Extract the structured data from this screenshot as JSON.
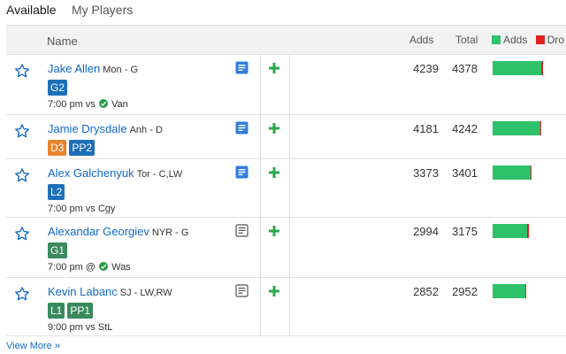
{
  "tabs": {
    "available": "Available",
    "my_players": "My Players"
  },
  "header": {
    "name": "Name",
    "adds": "Adds",
    "total": "Total",
    "legend_adds": "Adds",
    "legend_drops": "Dro"
  },
  "colors": {
    "adds": "#2ec26a",
    "drops": "#e02020",
    "link": "#1268c9"
  },
  "players": [
    {
      "name": "Jake Allen",
      "info": "Mon - G",
      "badges": [
        {
          "label": "G2",
          "color": "#1c6fb8"
        }
      ],
      "game_pre": "7:00 pm vs",
      "game_post": "Van",
      "check": true,
      "note_style": "blue",
      "adds": "4239",
      "total": "4378",
      "adds_fraction": 0.968,
      "drops_fraction": 0.032
    },
    {
      "name": "Jamie Drysdale",
      "info": "Anh - D",
      "badges": [
        {
          "label": "D3",
          "color": "#e8842c"
        },
        {
          "label": "PP2",
          "color": "#1c6fb8"
        }
      ],
      "game_pre": "",
      "game_post": "",
      "check": false,
      "note_style": "blue",
      "adds": "4181",
      "total": "4242",
      "adds_fraction": 0.986,
      "drops_fraction": 0.014
    },
    {
      "name": "Alex Galchenyuk",
      "info": "Tor - C,LW",
      "badges": [
        {
          "label": "L2",
          "color": "#1c6fb8"
        }
      ],
      "game_pre": "7:00 pm vs Cgy",
      "game_post": "",
      "check": false,
      "note_style": "blue",
      "adds": "3373",
      "total": "3401",
      "adds_fraction": 0.992,
      "drops_fraction": 0.008
    },
    {
      "name": "Alexandar Georgiev",
      "info": "NYR - G",
      "badges": [
        {
          "label": "G1",
          "color": "#3a8a5e"
        }
      ],
      "game_pre": "7:00 pm @",
      "game_post": "Was",
      "check": true,
      "note_style": "gray",
      "adds": "2994",
      "total": "3175",
      "adds_fraction": 0.943,
      "drops_fraction": 0.057
    },
    {
      "name": "Kevin Labanc",
      "info": "SJ - LW,RW",
      "badges": [
        {
          "label": "L1",
          "color": "#3a8a5e"
        },
        {
          "label": "PP1",
          "color": "#3a8a5e"
        }
      ],
      "game_pre": "9:00 pm vs StL",
      "game_post": "",
      "check": false,
      "note_style": "gray",
      "adds": "2852",
      "total": "2952",
      "adds_fraction": 0.966,
      "drops_fraction": 0.034
    }
  ],
  "footer": {
    "view_more": "View More »"
  }
}
